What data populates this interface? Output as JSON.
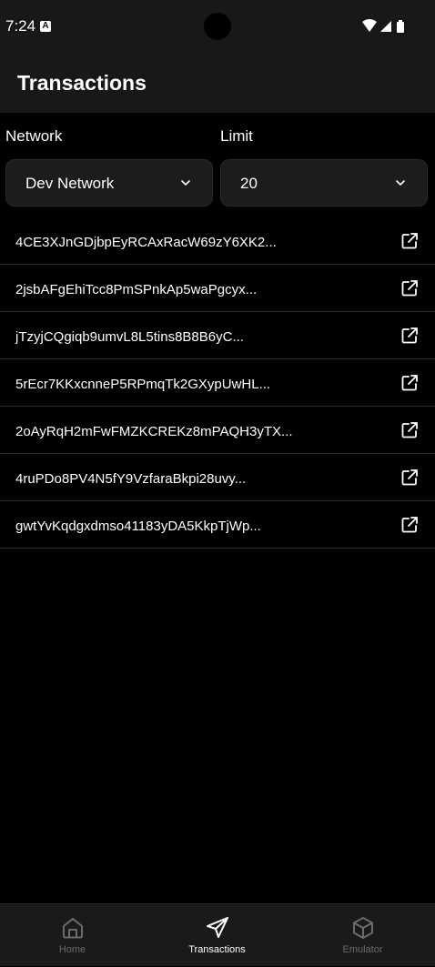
{
  "status_bar": {
    "time": "7:24",
    "notification_badge": "A"
  },
  "header": {
    "title": "Transactions"
  },
  "filters": {
    "network": {
      "label": "Network",
      "value": "Dev Network"
    },
    "limit": {
      "label": "Limit",
      "value": "20"
    }
  },
  "transactions": [
    {
      "id": "4CE3XJnGDjbpEyRCAxRacW69zY6XK2..."
    },
    {
      "id": "2jsbAFgEhiTcc8PmSPnkAp5waPgcyx..."
    },
    {
      "id": "jTzyjCQgiqb9umvL8L5tins8B8B6yC..."
    },
    {
      "id": "5rEcr7KKxcnneP5RPmqTk2GXypUwHL..."
    },
    {
      "id": "2oAyRqH2mFwFMZKCREKz8mPAQH3yTX..."
    },
    {
      "id": "4ruPDo8PV4N5fY9VzfaraBkpi28uvy..."
    },
    {
      "id": "gwtYvKqdgxdmso41183yDA5KkpTjWp..."
    }
  ],
  "bottom_nav": {
    "items": [
      {
        "label": "Home",
        "icon": "home-icon",
        "active": false
      },
      {
        "label": "Transactions",
        "icon": "send-icon",
        "active": true
      },
      {
        "label": "Emulator",
        "icon": "cube-icon",
        "active": false
      }
    ]
  },
  "colors": {
    "background": "#000000",
    "surface": "#181818",
    "select_bg": "#1c1c1c",
    "active_nav": "#ffffff",
    "inactive_nav": "#6b6b6b",
    "divider": "#2c2c2c"
  }
}
